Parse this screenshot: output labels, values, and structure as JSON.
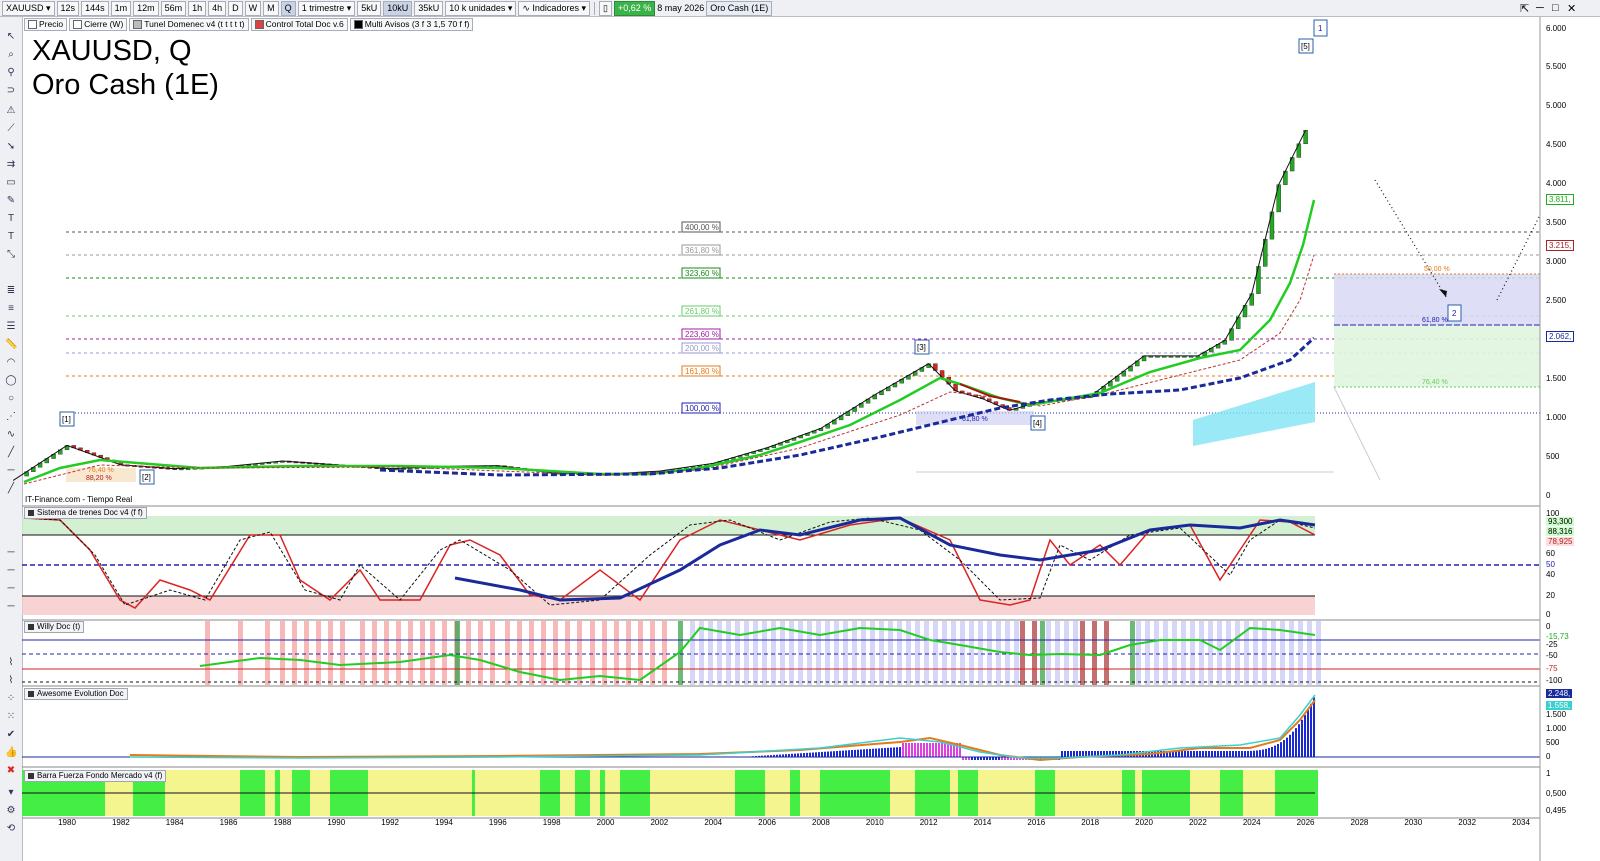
{
  "toolbar": {
    "symbol": "XAUUSD",
    "intervals": [
      "12s",
      "144s",
      "1m",
      "12m",
      "56m",
      "1h",
      "4h",
      "D",
      "W",
      "M",
      "Q"
    ],
    "active_interval": "Q",
    "period": "1 trimestre",
    "units": [
      "5kU",
      "10kU",
      "35kU"
    ],
    "active_unit": "10kU",
    "units_dropdown": "10 k unidades",
    "indicators": "Indicadores",
    "change": "+0,62 %",
    "date": "8 may 2026",
    "instrument": "Oro Cash (1E)"
  },
  "legend": {
    "items": [
      {
        "label": "Precio",
        "color": "#ffffff"
      },
      {
        "label": "Cierre (W)",
        "color": "#ffffff"
      },
      {
        "label": "Tunel Domenec v4 (t t t t t)",
        "color": "#bbbbbb"
      },
      {
        "label": "Control Total Doc v.6",
        "color": "#e04040"
      },
      {
        "label": "Multi Avisos (3 f 3 1,5 70 f f)",
        "color": "#000000"
      }
    ]
  },
  "chart_title": {
    "line1": "XAUUSD, Q",
    "line2": "Oro Cash (1E)"
  },
  "source": "IT-Finance.com - Tiempo Real",
  "wave_labels": [
    "[1]",
    "[2]",
    "[3]",
    "[4]",
    "[5]",
    "1",
    "2"
  ],
  "fib_labels": [
    {
      "label": "400,00 %",
      "color": "#555555"
    },
    {
      "label": "361,80 %",
      "color": "#999999"
    },
    {
      "label": "323,60 %",
      "color": "#1a8a1a"
    },
    {
      "label": "261,80 %",
      "color": "#66cc66"
    },
    {
      "label": "223,60 %",
      "color": "#a020a0"
    },
    {
      "label": "200,00 %",
      "color": "#9999cc"
    },
    {
      "label": "161,80 %",
      "color": "#e67a1a"
    },
    {
      "label": "100,00 %",
      "color": "#2020b0"
    }
  ],
  "small_fib": [
    "76,40 %",
    "88,20 %",
    "61,80 %",
    "50,00 %",
    "61,80 %",
    "76,40 %"
  ],
  "price_axis": [
    "6.000",
    "5.500",
    "5.000",
    "4.500",
    "4.000",
    "3.500",
    "3.000",
    "2.500",
    "2.000",
    "1.500",
    "1.000",
    "500",
    "0"
  ],
  "price_tags": [
    {
      "label": "3.811,",
      "color": "#22aa22"
    },
    {
      "label": "3.215,",
      "color": "#aa2222"
    },
    {
      "label": "2.062,",
      "color": "#1a2a9a"
    }
  ],
  "panels": {
    "trenes": {
      "label": "Sistema de trenes Doc v4 (f f)",
      "axis": [
        "100",
        "80",
        "60",
        "50",
        "40",
        "20",
        "0"
      ],
      "tags": [
        "93,300",
        "88,316",
        "78,925"
      ]
    },
    "willy": {
      "label": "Willy Doc (t)",
      "axis": [
        "0",
        "-25",
        "-50",
        "-75",
        "-100"
      ],
      "tags": [
        "-15,73"
      ]
    },
    "awesome": {
      "label": "Awesome Evolution Doc",
      "axis": [
        "1.500",
        "1.000",
        "500",
        "0"
      ],
      "tags": [
        "2.248,",
        "1.558,"
      ]
    },
    "barra": {
      "label": "Barra Fuerza Fondo Mercado v4 (f)",
      "axis": [
        "1",
        "0,500",
        "0,495"
      ]
    }
  },
  "time_axis": [
    "1980",
    "1982",
    "1984",
    "1986",
    "1988",
    "1990",
    "1992",
    "1994",
    "1996",
    "1998",
    "2000",
    "2002",
    "2004",
    "2006",
    "2008",
    "2010",
    "2012",
    "2014",
    "2016",
    "2018",
    "2020",
    "2022",
    "2024",
    "2026",
    "2028",
    "2030",
    "2032",
    "2034"
  ],
  "chart_data": {
    "type": "line",
    "title": "XAUUSD, Q",
    "subtitle": "Oro Cash (1E)",
    "xlabel": "",
    "ylabel": "",
    "ylim": [
      0,
      6000
    ],
    "x": [
      1978,
      1980,
      1982,
      1984,
      1986,
      1988,
      1990,
      1992,
      1994,
      1996,
      1998,
      2000,
      2002,
      2004,
      2006,
      2008,
      2010,
      2012,
      2013,
      2014,
      2015,
      2016,
      2018,
      2020,
      2022,
      2023,
      2024,
      2025,
      2026
    ],
    "series": [
      {
        "values": [
          200,
          650,
          400,
          350,
          380,
          450,
          400,
          350,
          380,
          390,
          300,
          280,
          320,
          420,
          620,
          870,
          1300,
          1700,
          1350,
          1250,
          1100,
          1200,
          1280,
          1800,
          1800,
          2000,
          2600,
          4000,
          4700
        ]
      }
    ]
  }
}
